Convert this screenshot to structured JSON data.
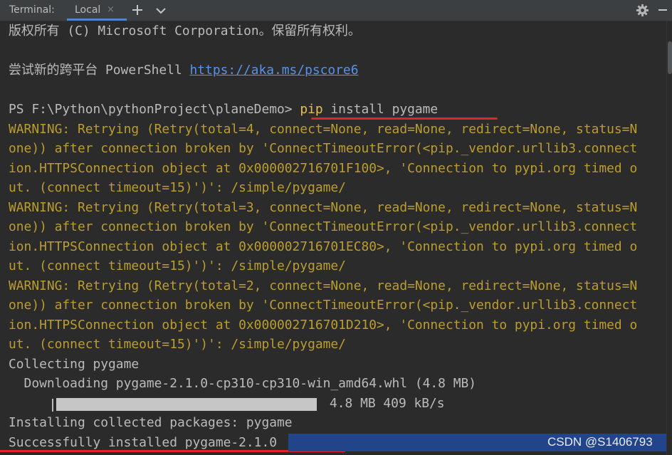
{
  "header": {
    "terminal_label": "Terminal:",
    "tab_label": "Local",
    "tab_close_glyph": "×",
    "icons": [
      "add-icon",
      "chevron-down-icon",
      "gear-icon",
      "minimize-icon"
    ]
  },
  "terminal": {
    "lines": [
      {
        "text": "版权所有 (C) Microsoft Corporation。保留所有权利。",
        "type": "normal"
      },
      {
        "text": "尝试新的跨平台 PowerShell ",
        "type": "normal",
        "link": "https://aka.ms/pscore6"
      },
      {
        "prompt": "PS F:\\Python\\pythonProject\\planeDemo> ",
        "command_word": "pip",
        "command_rest": " install pygame"
      },
      {
        "text": "WARNING: Retrying (Retry(total=4, connect=None, read=None, redirect=None, status=N",
        "type": "warn"
      },
      {
        "text": "one)) after connection broken by 'ConnectTimeoutError(<pip._vendor.urllib3.connect",
        "type": "warn"
      },
      {
        "text": "ion.HTTPSConnection object at 0x000002716701F100>, 'Connection to pypi.org timed o",
        "type": "warn"
      },
      {
        "text": "ut. (connect timeout=15)')': /simple/pygame/",
        "type": "warn"
      },
      {
        "text": "WARNING: Retrying (Retry(total=3, connect=None, read=None, redirect=None, status=N",
        "type": "warn"
      },
      {
        "text": "one)) after connection broken by 'ConnectTimeoutError(<pip._vendor.urllib3.connect",
        "type": "warn"
      },
      {
        "text": "ion.HTTPSConnection object at 0x000002716701EC80>, 'Connection to pypi.org timed o",
        "type": "warn"
      },
      {
        "text": "ut. (connect timeout=15)')': /simple/pygame/",
        "type": "warn"
      },
      {
        "text": "WARNING: Retrying (Retry(total=2, connect=None, read=None, redirect=None, status=N",
        "type": "warn"
      },
      {
        "text": "one)) after connection broken by 'ConnectTimeoutError(<pip._vendor.urllib3.connect",
        "type": "warn"
      },
      {
        "text": "ion.HTTPSConnection object at 0x000002716701D210>, 'Connection to pypi.org timed o",
        "type": "warn"
      },
      {
        "text": "ut. (connect timeout=15)')': /simple/pygame/",
        "type": "warn"
      },
      {
        "text": "Collecting pygame",
        "type": "normal"
      },
      {
        "text": "  Downloading pygame-2.1.0-cp310-cp310-win_amd64.whl (4.8 MB)",
        "type": "normal"
      },
      {
        "text": "4.8 MB 409 kB/s",
        "type": "normal"
      },
      {
        "text": "Installing collected packages: pygame",
        "type": "normal"
      },
      {
        "text": "Successfully installed pygame-2.1.0",
        "type": "normal"
      }
    ],
    "download_progress": 1.0
  },
  "watermark": "CSDN @S1406793",
  "colors": {
    "background": "#2b2b2b",
    "text": "#bbbbbb",
    "warning": "#bb9d2f",
    "link": "#5394ec",
    "command": "#e8c04b",
    "annotation_underline": "#e0242b",
    "highlight_band": "#21448a"
  }
}
